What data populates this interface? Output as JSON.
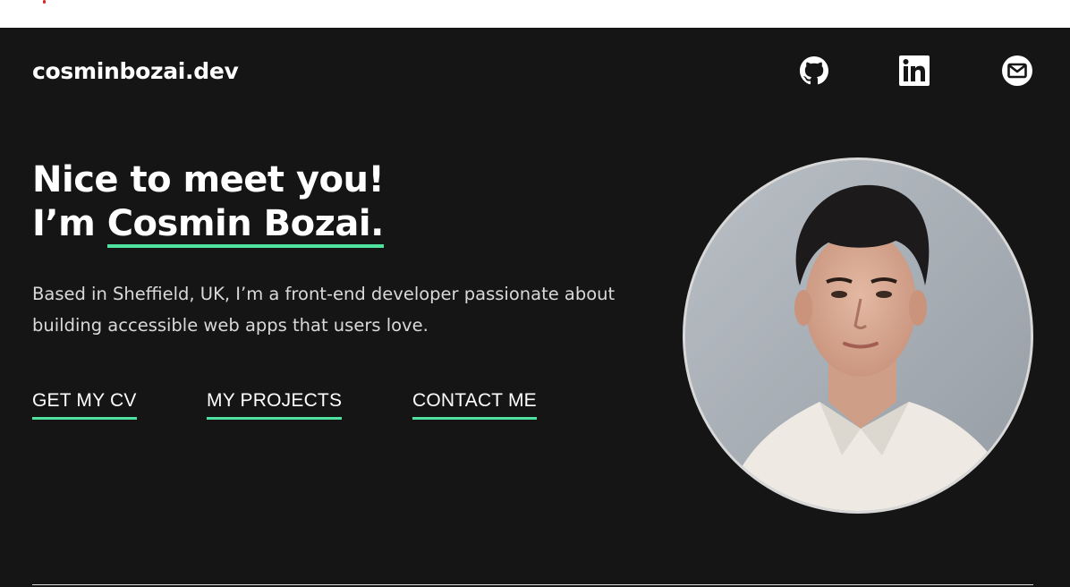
{
  "site": {
    "logo": "cosminbozai.dev"
  },
  "social": {
    "github_icon": "github-icon",
    "linkedin_icon": "linkedin-icon",
    "mail_icon": "mail-icon"
  },
  "hero": {
    "heading_line1": "Nice to meet you!",
    "heading_prefix": "I’m ",
    "name": "Cosmin Bozai.",
    "description": "Based in Sheffield, UK, I’m a front-end developer passionate about building accessible web apps that users love."
  },
  "cta": {
    "cv": "GET MY CV",
    "projects": "MY PROJECTS",
    "contact": "CONTACT ME"
  },
  "colors": {
    "background": "#151515",
    "accent": "#4ee1a0",
    "text": "#ffffff"
  }
}
